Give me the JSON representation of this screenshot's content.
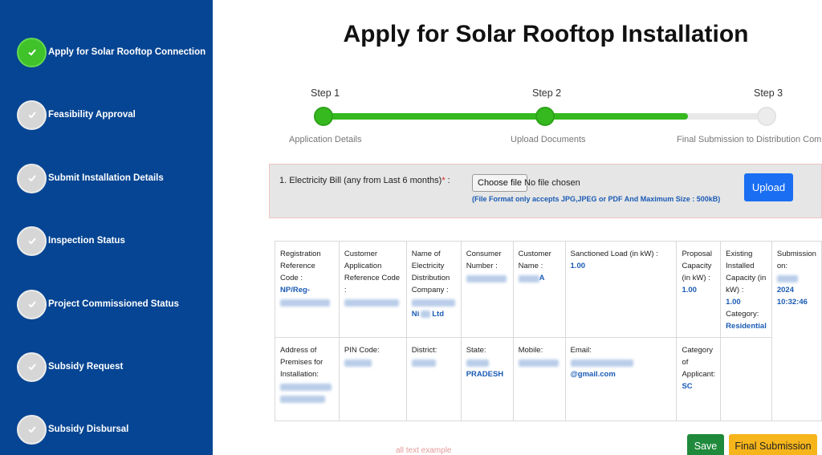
{
  "sidebar": {
    "items": [
      {
        "label": "Apply for Solar Rooftop Connection",
        "status": "completed"
      },
      {
        "label": "Feasibility Approval",
        "status": "pending"
      },
      {
        "label": "Submit Installation Details",
        "status": "pending"
      },
      {
        "label": "Inspection Status",
        "status": "pending"
      },
      {
        "label": "Project Commissioned Status",
        "status": "pending"
      },
      {
        "label": "Subsidy Request",
        "status": "pending"
      },
      {
        "label": "Subsidy Disbursal",
        "status": "pending"
      }
    ]
  },
  "main": {
    "title": "Apply for Solar Rooftop Installation",
    "steps": [
      {
        "label": "Step 1",
        "sub": "Application Details",
        "status": "done"
      },
      {
        "label": "Step 2",
        "sub": "Upload Documents",
        "status": "done"
      },
      {
        "label": "Step 3",
        "sub": "Final Submission to Distribution Compar",
        "status": "pending"
      }
    ],
    "progress_fraction": 0.81,
    "upload": {
      "label": "1. Electricity Bill (any from Last 6 months)",
      "required_mark": "*",
      "colon": " :",
      "choose_button": "Choose file",
      "file_status": "No file chosen",
      "format_note": "(File Format only accepts JPG,JPEG or PDF And Maximum Size : 500kB)",
      "upload_button": "Upload"
    },
    "details": {
      "registration": {
        "label": "Registration Reference Code :",
        "value": "NP/Reg-"
      },
      "customer_app_ref": {
        "label": "Customer Application Reference Code :"
      },
      "discom": {
        "label": "Name of Electricity Distribution Company :",
        "value": "Ni",
        "value_suffix": "Ltd"
      },
      "consumer_number": {
        "label": "Consumer Number :"
      },
      "customer_name": {
        "label": "Customer Name :",
        "value": "A"
      },
      "sanctioned_load": {
        "label": "Sanctioned Load (in kW) :",
        "value": "1.00"
      },
      "proposal_capacity": {
        "label": "Proposal Capacity (in kW) :",
        "value": "1.00"
      },
      "existing_capacity": {
        "label": "Existing Installed Capacity (in kW) :",
        "value": "1.00"
      },
      "category": {
        "label": "Category:",
        "value": "Residential"
      },
      "submission": {
        "label": "Submission on:",
        "value_line1": "2024",
        "value_line2": "10:32:46"
      },
      "address": {
        "label": "Address of Premises for Installation:"
      },
      "pin": {
        "label": "PIN Code:"
      },
      "district": {
        "label": "District:"
      },
      "state": {
        "label": "State:",
        "value": "PRADESH"
      },
      "mobile": {
        "label": "Mobile:"
      },
      "email": {
        "label": "Email:",
        "value": "@gmail.com"
      },
      "category_applicant": {
        "label": "Category of Applicant:",
        "value": "SC"
      }
    },
    "buttons": {
      "save": "Save",
      "final": "Final Submission"
    },
    "footer_note": "all text example"
  },
  "colors": {
    "sidebar_bg": "#064593",
    "progress": "#35b91f",
    "upload_button": "#1a6ef2",
    "save_button": "#1f8a3b",
    "final_button": "#f6b51b",
    "value_text": "#1a5bb4"
  }
}
